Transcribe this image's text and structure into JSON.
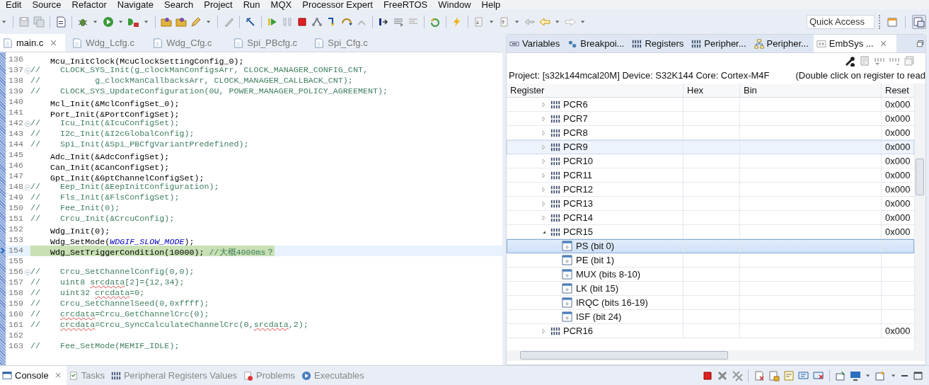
{
  "menu": [
    "Edit",
    "Source",
    "Refactor",
    "Navigate",
    "Search",
    "Project",
    "Run",
    "MQX",
    "Processor Expert",
    "FreeRTOS",
    "Window",
    "Help"
  ],
  "toolbar": {
    "quick_access": {
      "placeholder": "Quick Access"
    }
  },
  "editor": {
    "tabs": [
      {
        "label": "main.c",
        "selected": true
      },
      {
        "label": "Wdg_Lcfg.c",
        "selected": false
      },
      {
        "label": "Wdg_Cfg.c",
        "selected": false
      },
      {
        "label": "Spi_PBcfg.c",
        "selected": false
      },
      {
        "label": "Spi_Cfg.c",
        "selected": false
      }
    ],
    "lines": [
      {
        "number": "136",
        "fold": false,
        "current": false,
        "segments": [
          {
            "kind": "code",
            "text": "    Mcu_InitClock(McuClockSettingConfig_0);"
          }
        ]
      },
      {
        "number": "137",
        "fold": true,
        "current": false,
        "segments": [
          {
            "kind": "comment",
            "text": "//    CLOCK_SYS_Init(g_clockManConfigsArr, CLOCK_MANAGER_CONFIG_CNT,"
          }
        ]
      },
      {
        "number": "138",
        "fold": false,
        "current": false,
        "segments": [
          {
            "kind": "comment",
            "text": "//           g_clockManCallbacksArr, CLOCK_MANAGER_CALLBACK_CNT);"
          }
        ]
      },
      {
        "number": "139",
        "fold": false,
        "current": false,
        "segments": [
          {
            "kind": "comment",
            "text": "//    CLOCK_SYS_UpdateConfiguration(0U, POWER_MANAGER_POLICY_AGREEMENT);"
          }
        ]
      },
      {
        "number": "140",
        "fold": false,
        "current": false,
        "segments": [
          {
            "kind": "code",
            "text": "    Mcl_Init(&MclConfigSet_0);"
          }
        ]
      },
      {
        "number": "141",
        "fold": false,
        "current": false,
        "segments": [
          {
            "kind": "code",
            "text": "    Port_Init(&PortConfigSet);"
          }
        ]
      },
      {
        "number": "142",
        "fold": true,
        "current": false,
        "segments": [
          {
            "kind": "comment",
            "text": "//    Icu_Init(&IcuConfigSet);"
          }
        ]
      },
      {
        "number": "143",
        "fold": false,
        "current": false,
        "segments": [
          {
            "kind": "comment",
            "text": "//    I2c_Init(&I2cGlobalConfig);"
          }
        ]
      },
      {
        "number": "144",
        "fold": false,
        "current": false,
        "segments": [
          {
            "kind": "comment",
            "text": "//    Spi_Init(&Spi_PBCfgVariantPredefined);"
          }
        ]
      },
      {
        "number": "145",
        "fold": false,
        "current": false,
        "segments": [
          {
            "kind": "code",
            "text": "    Adc_Init(&AdcConfigSet);"
          }
        ]
      },
      {
        "number": "146",
        "fold": false,
        "current": false,
        "segments": [
          {
            "kind": "code",
            "text": "    Can_Init(&CanConfigSet);"
          }
        ]
      },
      {
        "number": "147",
        "fold": false,
        "current": false,
        "segments": [
          {
            "kind": "code",
            "text": "    Gpt_Init(&GptChannelConfigSet);"
          }
        ]
      },
      {
        "number": "148",
        "fold": true,
        "current": false,
        "segments": [
          {
            "kind": "comment",
            "text": "//    Eep_Init(&EepInitConfiguration);"
          }
        ]
      },
      {
        "number": "149",
        "fold": false,
        "current": false,
        "segments": [
          {
            "kind": "comment",
            "text": "//    Fls_Init(&FlsConfigSet);"
          }
        ]
      },
      {
        "number": "150",
        "fold": false,
        "current": false,
        "segments": [
          {
            "kind": "comment",
            "text": "//    Fee_Init(0);"
          }
        ]
      },
      {
        "number": "151",
        "fold": false,
        "current": false,
        "segments": [
          {
            "kind": "comment",
            "text": "//    Crcu_Init(&CrcuConfig);"
          }
        ]
      },
      {
        "number": "152",
        "fold": false,
        "current": false,
        "segments": [
          {
            "kind": "code",
            "text": "    Wdg_Init(0);"
          }
        ]
      },
      {
        "number": "153",
        "fold": false,
        "current": false,
        "segments": [
          {
            "kind": "code",
            "text": "    Wdg_SetMode("
          },
          {
            "kind": "constant",
            "text": "WDGIF_SLOW_MODE"
          },
          {
            "kind": "code",
            "text": ");"
          }
        ]
      },
      {
        "number": "154",
        "fold": false,
        "current": true,
        "segments": [
          {
            "kind": "code",
            "text": "    Wdg_SetTriggerCondition(10000); "
          },
          {
            "kind": "comment",
            "text": "//大概4000ms？"
          }
        ]
      },
      {
        "number": "155",
        "fold": false,
        "current": false
      },
      {
        "number": "156",
        "fold": true,
        "current": false,
        "segments": [
          {
            "kind": "comment",
            "text": "//    Crcu_SetChannelConfig(0,0);"
          }
        ]
      },
      {
        "number": "157",
        "fold": false,
        "current": false,
        "segments": [
          {
            "kind": "comment",
            "text": "//    uint8 "
          },
          {
            "kind": "flagged",
            "text": "srcdata"
          },
          {
            "kind": "comment",
            "text": "[2]={12,34};"
          }
        ]
      },
      {
        "number": "158",
        "fold": false,
        "current": false,
        "segments": [
          {
            "kind": "comment",
            "text": "//    uint32 "
          },
          {
            "kind": "flagged",
            "text": "crcdata"
          },
          {
            "kind": "comment",
            "text": "=0;"
          }
        ]
      },
      {
        "number": "159",
        "fold": false,
        "current": false,
        "segments": [
          {
            "kind": "comment",
            "text": "//    Crcu_SetChannelSeed(0,0xffff);"
          }
        ]
      },
      {
        "number": "160",
        "fold": false,
        "current": false,
        "segments": [
          {
            "kind": "comment",
            "text": "//    "
          },
          {
            "kind": "flagged",
            "text": "crcdata"
          },
          {
            "kind": "comment",
            "text": "=Crcu_GetChannelCrc(0);"
          }
        ]
      },
      {
        "number": "161",
        "fold": false,
        "current": false,
        "segments": [
          {
            "kind": "comment",
            "text": "//    "
          },
          {
            "kind": "flagged",
            "text": "crcdata"
          },
          {
            "kind": "comment",
            "text": "=Crcu_SyncCalculateChannelCrc(0,"
          },
          {
            "kind": "flagged",
            "text": "srcdata"
          },
          {
            "kind": "comment",
            "text": ",2);"
          }
        ]
      },
      {
        "number": "162",
        "fold": false,
        "current": false
      },
      {
        "number": "163",
        "fold": false,
        "current": false,
        "segments": [
          {
            "kind": "comment",
            "text": "//    Fee_SetMode(MEMIF_IDLE);"
          }
        ]
      }
    ]
  },
  "view": {
    "tabs": [
      {
        "label": "Variables",
        "selected": false
      },
      {
        "label": "Breakpoi...",
        "selected": false
      },
      {
        "label": "Registers",
        "selected": false
      },
      {
        "label": "Peripher...",
        "selected": false
      },
      {
        "label": "Peripher...",
        "selected": false
      },
      {
        "label": "EmbSys ...",
        "selected": true
      }
    ],
    "info": "Project: [s32k144mcal20M] Device: S32K144 Core: Cortex-M4F",
    "hint": "(Double click on register to read",
    "columns": [
      "Register",
      "Hex",
      "Bin",
      "Reset"
    ],
    "registers": [
      {
        "name": "PCR6",
        "reset": "0x000",
        "expanded": false,
        "selected": false,
        "hovered": false
      },
      {
        "name": "PCR7",
        "reset": "0x000",
        "expanded": false,
        "selected": false,
        "hovered": false
      },
      {
        "name": "PCR8",
        "reset": "0x000",
        "expanded": false,
        "selected": false,
        "hovered": false
      },
      {
        "name": "PCR9",
        "reset": "0x000",
        "expanded": false,
        "selected": false,
        "hovered": true
      },
      {
        "name": "PCR10",
        "reset": "0x000",
        "expanded": false,
        "selected": false,
        "hovered": false
      },
      {
        "name": "PCR11",
        "reset": "0x000",
        "expanded": false,
        "selected": false,
        "hovered": false
      },
      {
        "name": "PCR12",
        "reset": "0x000",
        "expanded": false,
        "selected": false,
        "hovered": false
      },
      {
        "name": "PCR13",
        "reset": "0x000",
        "expanded": false,
        "selected": false,
        "hovered": false
      },
      {
        "name": "PCR14",
        "reset": "0x000",
        "expanded": false,
        "selected": false,
        "hovered": false
      },
      {
        "name": "PCR15",
        "reset": "0x000",
        "expanded": true,
        "selected": false,
        "hovered": false,
        "children": [
          {
            "name": "PS (bit 0)",
            "selected": true
          },
          {
            "name": "PE (bit 1)",
            "selected": false
          },
          {
            "name": "MUX (bits 8-10)",
            "selected": false
          },
          {
            "name": "LK (bit 15)",
            "selected": false
          },
          {
            "name": "IRQC (bits 16-19)",
            "selected": false
          },
          {
            "name": "ISF (bit 24)",
            "selected": false
          }
        ]
      },
      {
        "name": "PCR16",
        "reset": "0x000",
        "expanded": false,
        "selected": false,
        "hovered": false
      }
    ]
  },
  "bottom": {
    "tabs": [
      {
        "label": "Console",
        "selected": true
      },
      {
        "label": "Tasks",
        "selected": false
      },
      {
        "label": "Peripheral Registers Values",
        "selected": false
      },
      {
        "label": "Problems",
        "selected": false
      },
      {
        "label": "Executables",
        "selected": false
      }
    ]
  }
}
